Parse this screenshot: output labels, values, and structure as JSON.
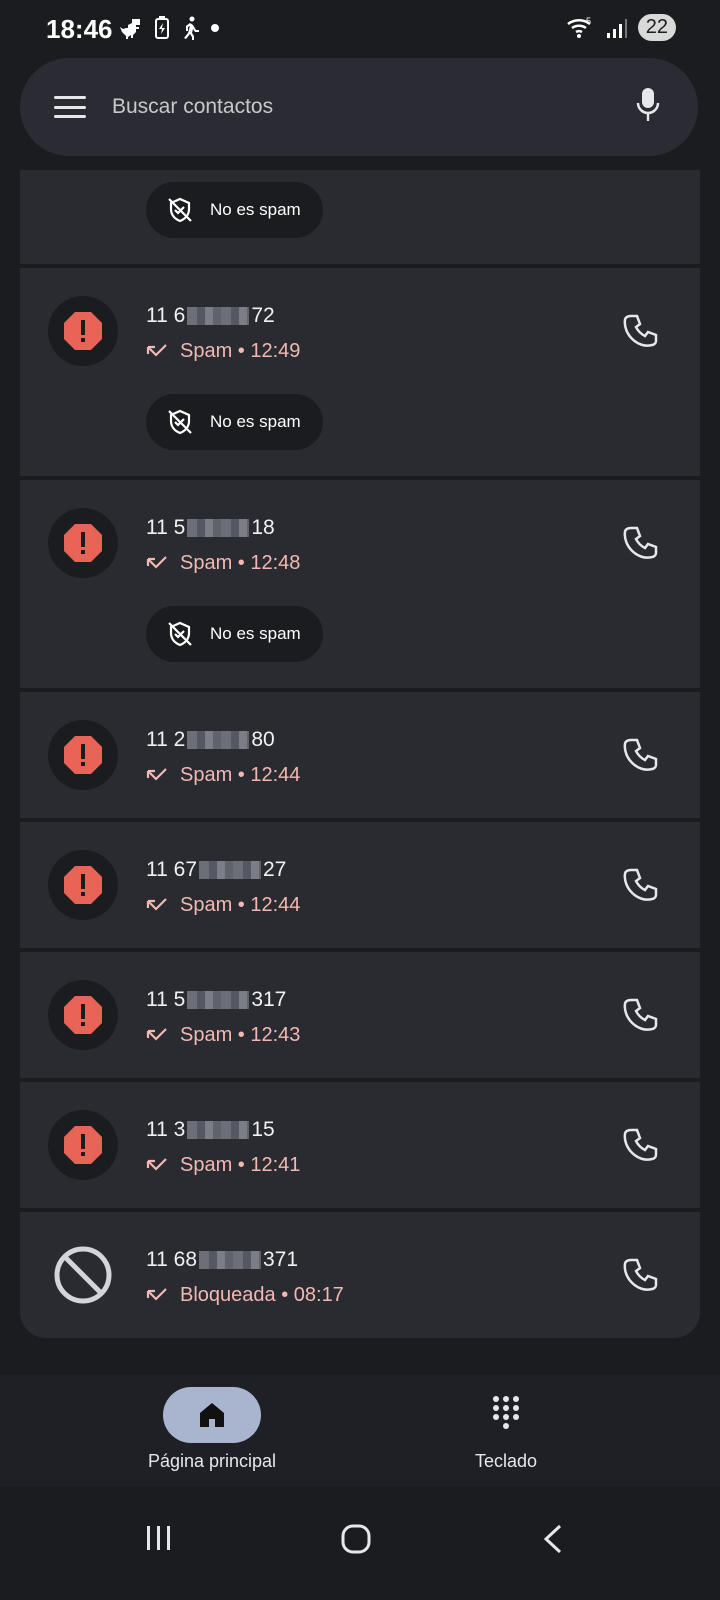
{
  "status_bar": {
    "time": "18:46",
    "battery": "22",
    "icons_left": [
      "dino-icon",
      "battery-saver-icon",
      "walk-icon",
      "dot-icon"
    ],
    "icons_right": [
      "wifi-icon",
      "signal-icon"
    ]
  },
  "search": {
    "placeholder": "Buscar contactos"
  },
  "calls": [
    {
      "id": "partial",
      "not_spam_label": "No es spam"
    },
    {
      "number_prefix": "11 6",
      "number_suffix": "72",
      "status": "Spam • 12:49",
      "not_spam_label": "No es spam",
      "type": "spam"
    },
    {
      "number_prefix": "11 5",
      "number_suffix": "18",
      "status": "Spam • 12:48",
      "not_spam_label": "No es spam",
      "type": "spam"
    },
    {
      "number_prefix": "11 2",
      "number_suffix": "80",
      "status": "Spam • 12:44",
      "type": "spam"
    },
    {
      "number_prefix": "11 67",
      "number_suffix": "27",
      "status": "Spam • 12:44",
      "type": "spam"
    },
    {
      "number_prefix": "11 5",
      "number_suffix": "317",
      "status": "Spam • 12:43",
      "type": "spam"
    },
    {
      "number_prefix": "11 3",
      "number_suffix": "15",
      "status": "Spam • 12:41",
      "type": "spam"
    },
    {
      "number_prefix": "11 68",
      "number_suffix": "371",
      "status": "Bloqueada • 08:17",
      "type": "blocked"
    }
  ],
  "bottom_nav": {
    "home_label": "Página principal",
    "keypad_label": "Teclado"
  },
  "colors": {
    "spam_red": "#e86456",
    "status_pink": "#f2b8b1",
    "card_bg": "#2a2b31",
    "page_bg": "#1b1c20",
    "active_pill": "#a9b4cf"
  }
}
